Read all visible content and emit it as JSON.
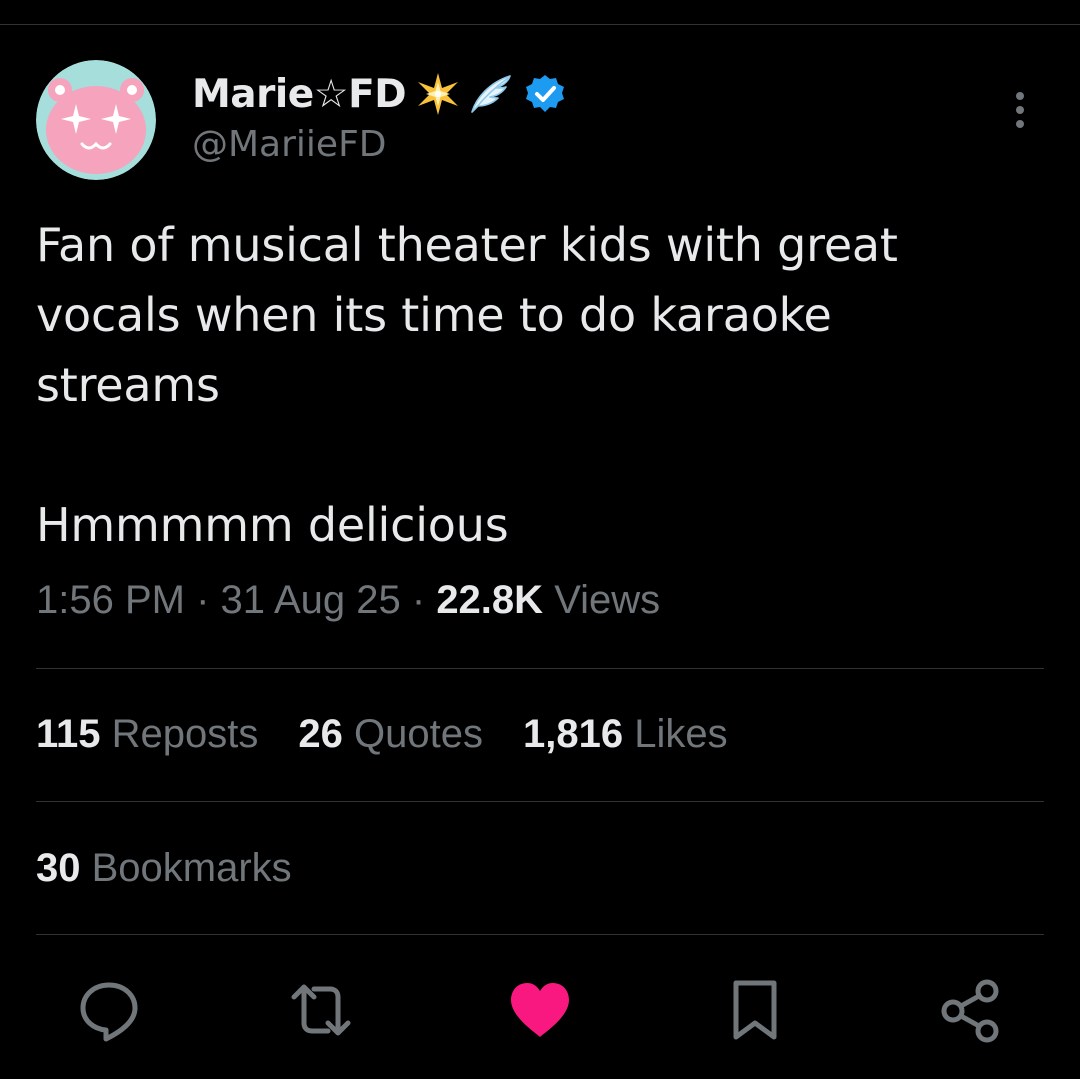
{
  "post": {
    "author": {
      "display_name": "Marie☆FD",
      "handle": "@MariieFD",
      "verified": true,
      "name_emojis": [
        "sparkle-star",
        "wing"
      ]
    },
    "text_lines": [
      "Fan of musical theater kids with great",
      "vocals when its time to do karaoke",
      "streams"
    ],
    "text_line_2": "Hmmmmm delicious",
    "meta": {
      "time": "1:56 PM",
      "date": "31 Aug 25",
      "separator": "·",
      "views_count": "22.8K",
      "views_label": "Views"
    },
    "stats": [
      {
        "count": "115",
        "label": "Reposts"
      },
      {
        "count": "26",
        "label": "Quotes"
      },
      {
        "count": "1,816",
        "label": "Likes"
      }
    ],
    "bookmarks": {
      "count": "30",
      "label": "Bookmarks"
    },
    "actions": {
      "icons": [
        "reply-icon",
        "repost-icon",
        "like-icon",
        "bookmark-icon",
        "share-icon"
      ],
      "liked": true
    }
  },
  "colors": {
    "background": "#000000",
    "text_primary": "#e7e9ea",
    "text_secondary": "#71767b",
    "divider": "#2f3336",
    "like_active": "#f91880",
    "verified_badge": "#1d9bf0",
    "avatar_bg": "#a6dedb",
    "avatar_face": "#f6a3bd"
  }
}
